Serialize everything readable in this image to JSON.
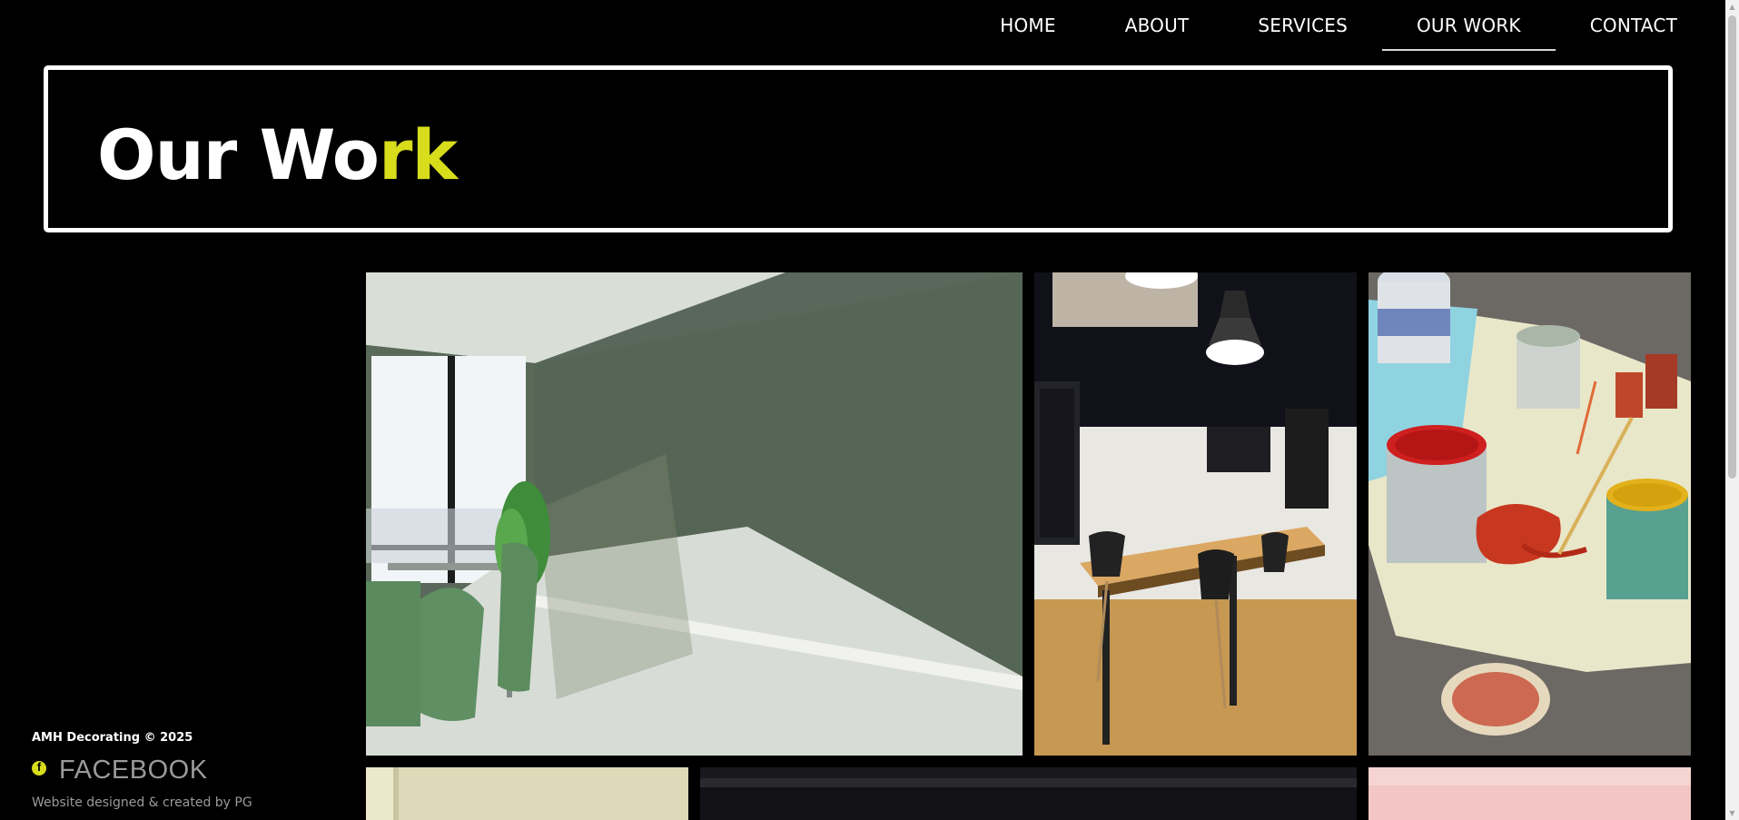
{
  "nav": {
    "items": [
      {
        "label": "HOME"
      },
      {
        "label": "ABOUT"
      },
      {
        "label": "SERVICES"
      },
      {
        "label": "OUR WORK",
        "active": true
      },
      {
        "label": "CONTACT"
      }
    ]
  },
  "hero": {
    "title_main": "Our Wo",
    "title_accent": "rk"
  },
  "footer": {
    "copyright": "AMH Decorating © 2025",
    "facebook_label": "FACEBOOK",
    "credit": "Website designed & created by PG"
  },
  "colors": {
    "background": "#000000",
    "accent": "#d7dc1b",
    "text": "#ffffff",
    "muted": "#9a9a9a"
  },
  "gallery": {
    "images": [
      {
        "name": "green-room-photo"
      },
      {
        "name": "meeting-room-photo"
      },
      {
        "name": "paint-cans-photo"
      },
      {
        "name": "cream-wall-photo"
      },
      {
        "name": "dark-fireplace-photo"
      },
      {
        "name": "pink-wall-photo"
      }
    ]
  }
}
